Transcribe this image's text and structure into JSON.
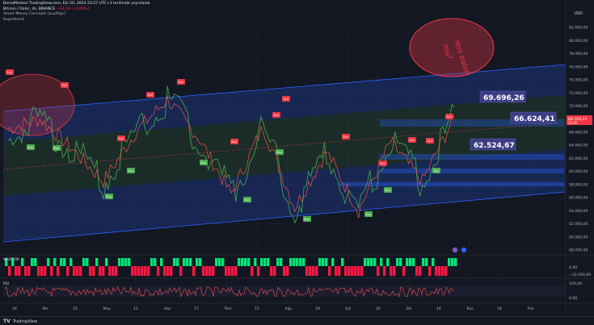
{
  "header": {
    "publish_line": "BorsaMerkezi TradingView.com, Eki 20, 2024 23:27 UTC+3 tarihinde yayınlandı",
    "symbol_line": "Bitcoin / Dolar, 4s, BINANCE",
    "change": "−40,19 (−0,06%)",
    "indicator_1": "Smart Money Concepts [LuxAlgo]",
    "indicator_2": "Supertrend"
  },
  "currency": "USD",
  "price_axis": {
    "ticks": [
      {
        "label": "82.000,00",
        "value": 82000
      },
      {
        "label": "80.000,00",
        "value": 80000
      },
      {
        "label": "78.000,00",
        "value": 78000
      },
      {
        "label": "76.000,00",
        "value": 76000
      },
      {
        "label": "74.000,00",
        "value": 74000
      },
      {
        "label": "72.000,00",
        "value": 72000
      },
      {
        "label": "70.000,00",
        "value": 70000
      },
      {
        "label": "68.000,00",
        "value": 68000
      },
      {
        "label": "66.000,00",
        "value": 66000
      },
      {
        "label": "64.000,00",
        "value": 64000
      },
      {
        "label": "62.000,00",
        "value": 62000
      },
      {
        "label": "60.000,00",
        "value": 60000
      },
      {
        "label": "58.000,00",
        "value": 58000
      },
      {
        "label": "56.000,00",
        "value": 56000
      },
      {
        "label": "54.000,00",
        "value": 54000
      },
      {
        "label": "52.000,00",
        "value": 52000
      },
      {
        "label": "50.000,00",
        "value": 50000
      },
      {
        "label": "48.000,00",
        "value": 48000
      }
    ],
    "current_price": "68.264,21",
    "current_time": "22:05"
  },
  "annotations": {
    "bubble_text_1": "Yeni balon",
    "bubble_text_2": "mu?",
    "level_1": "69.696,26",
    "level_2": "66.624,41",
    "level_3": "62.524,67"
  },
  "time_axis": [
    "18",
    "Nis",
    "15",
    "May",
    "13",
    "Haz",
    "17",
    "Tem",
    "15",
    "Ağu",
    "19",
    "Eyl",
    "16",
    "Eki",
    "14",
    "Kas",
    "18",
    "Ara"
  ],
  "panel1": {
    "label": "WAZOOK",
    "ticks": [
      "0,00",
      "−10.000,00"
    ]
  },
  "panel2": {
    "label": "RSI",
    "ticks": [
      "100,00",
      "0,00"
    ]
  },
  "footer": {
    "brand": "TradingView"
  },
  "colors": {
    "background": "#131722",
    "channel_blue": "#2962ff",
    "channel_green": "#4caf50",
    "sell": "#f23645",
    "buy": "#4caf50",
    "bubble": "#f23645",
    "label_bg": "#3d3d85"
  },
  "signals": {
    "sell": "Sell",
    "buy": "Buy"
  },
  "chart_data": {
    "type": "line",
    "symbol": "Bitcoin / Dolar, 4s, BINANCE",
    "ylim": [
      46000,
      84000
    ],
    "x": [
      "18",
      "Nis",
      "15",
      "May",
      "13",
      "Haz",
      "17",
      "Tem",
      "15",
      "Ağu",
      "19",
      "Eyl",
      "16",
      "Eki",
      "14"
    ],
    "series": [
      {
        "values": [
          66500,
          68000,
          63500,
          58500,
          66000,
          71000,
          65000,
          56500,
          66800,
          54500,
          63000,
          54000,
          64500,
          58500,
          68264
        ]
      }
    ]
  }
}
